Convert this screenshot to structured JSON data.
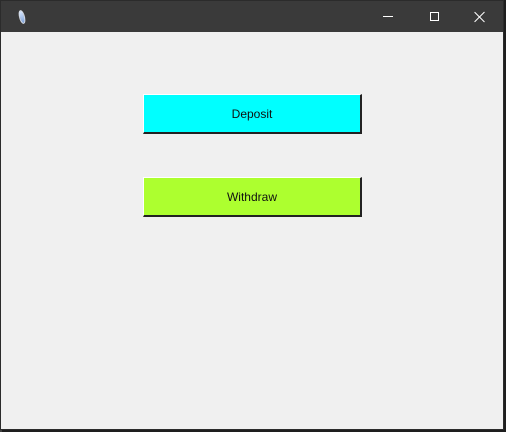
{
  "window": {
    "title": "",
    "app_icon": "feather-icon"
  },
  "titlebar": {
    "controls": [
      {
        "name": "minimize",
        "icon": "minimize-icon"
      },
      {
        "name": "maximize",
        "icon": "maximize-icon"
      },
      {
        "name": "close",
        "icon": "close-icon"
      }
    ]
  },
  "buttons": {
    "deposit_label": "Deposit",
    "withdraw_label": "Withdraw"
  },
  "colors": {
    "titlebar": "#3a3a3a",
    "background": "#f0f0f0",
    "deposit": "#00ffff",
    "withdraw": "#adff2f"
  }
}
